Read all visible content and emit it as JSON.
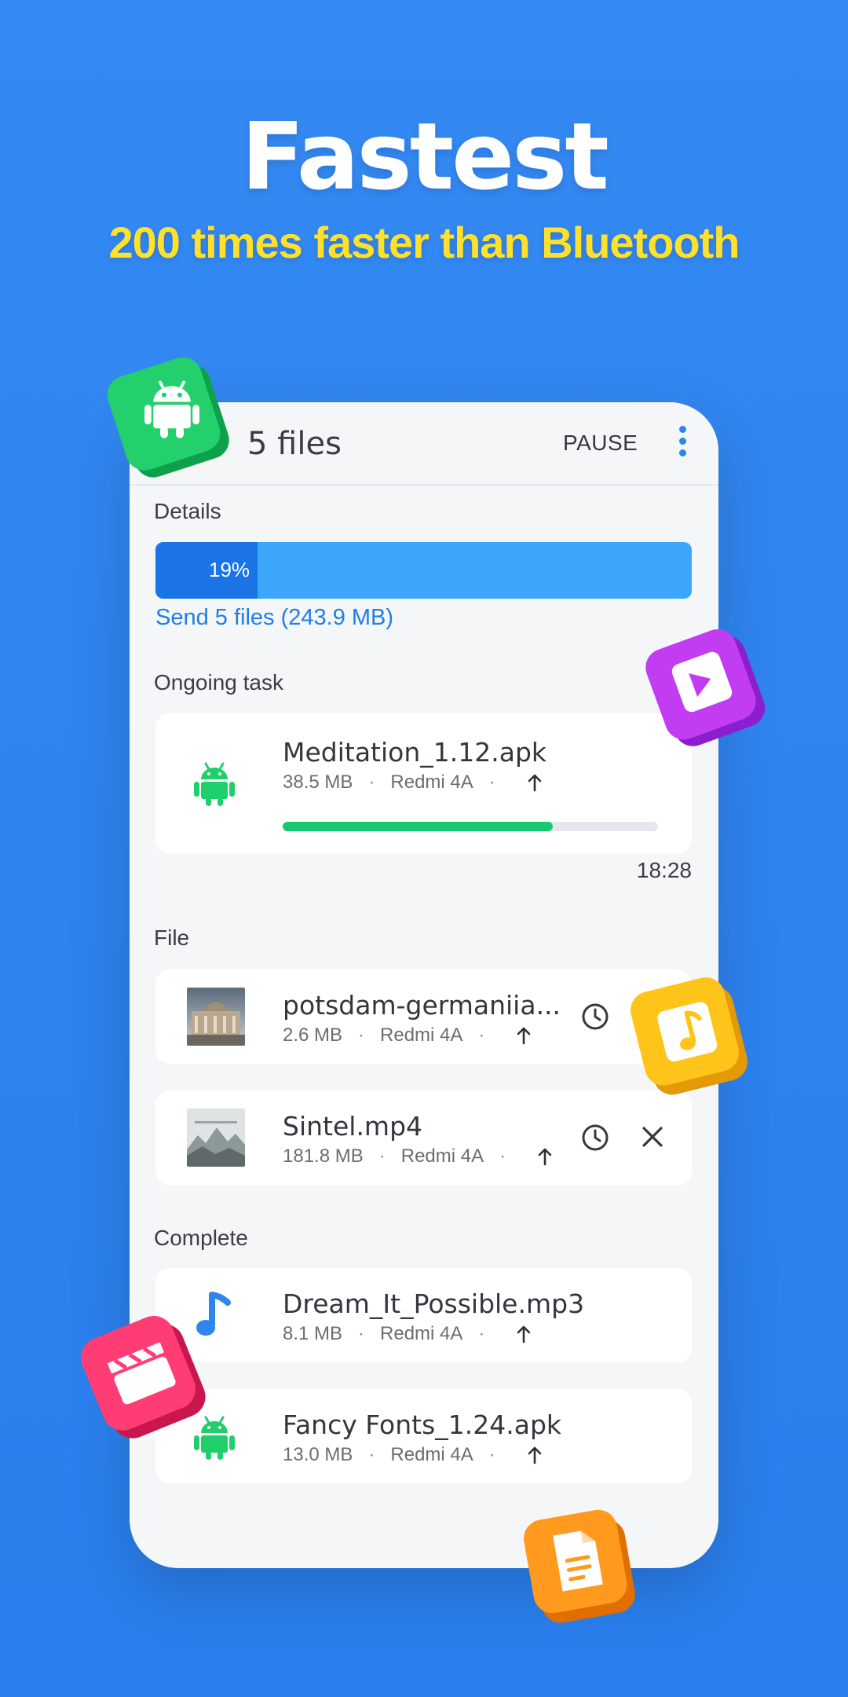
{
  "promo": {
    "headline": "Fastest",
    "subheadline": "200 times faster than Bluetooth"
  },
  "appbar": {
    "title": "5 files",
    "pause_label": "PAUSE",
    "more_icon": "more-vert-icon"
  },
  "details": {
    "label": "Details",
    "progress_percent": 19,
    "progress_text": "19%",
    "summary": "Send 5 files (243.9 MB)"
  },
  "ongoing": {
    "label": "Ongoing task",
    "file": {
      "name": "Meditation_1.12.apk",
      "size": "38.5 MB",
      "device": "Redmi 4A",
      "direction_icon": "arrow-up-icon",
      "type_icon": "android-icon",
      "progress_fraction": 0.72
    },
    "time": "18:28"
  },
  "file_section": {
    "label": "File",
    "items": [
      {
        "name": "potsdam-germaniia...",
        "size": "2.6 MB",
        "device": "Redmi 4A",
        "status_icon": "clock-icon"
      },
      {
        "name": "Sintel.mp4",
        "size": "181.8 MB",
        "device": "Redmi 4A",
        "status_icon": "clock-icon",
        "action_icon": "close-icon"
      }
    ]
  },
  "complete_section": {
    "label": "Complete",
    "items": [
      {
        "name": "Dream_It_Possible.mp3",
        "size": "8.1 MB",
        "device": "Redmi 4A",
        "type_icon": "music-note-icon"
      },
      {
        "name": "Fancy Fonts_1.24.apk",
        "size": "13.0 MB",
        "device": "Redmi 4A",
        "type_icon": "android-icon"
      }
    ]
  },
  "separator": "·",
  "colors": {
    "background": "#2f84f0",
    "headline": "#ffffff",
    "subheadline": "#ffe02a",
    "accent_blue": "#1f7ee8",
    "progress_track": "#3ba6fa",
    "task_progress": "#18c772",
    "android_green": "#1fcf6c"
  },
  "decorations": [
    "android-cube-icon",
    "video-cube-icon",
    "music-cube-icon",
    "clapper-cube-icon",
    "document-cube-icon"
  ]
}
